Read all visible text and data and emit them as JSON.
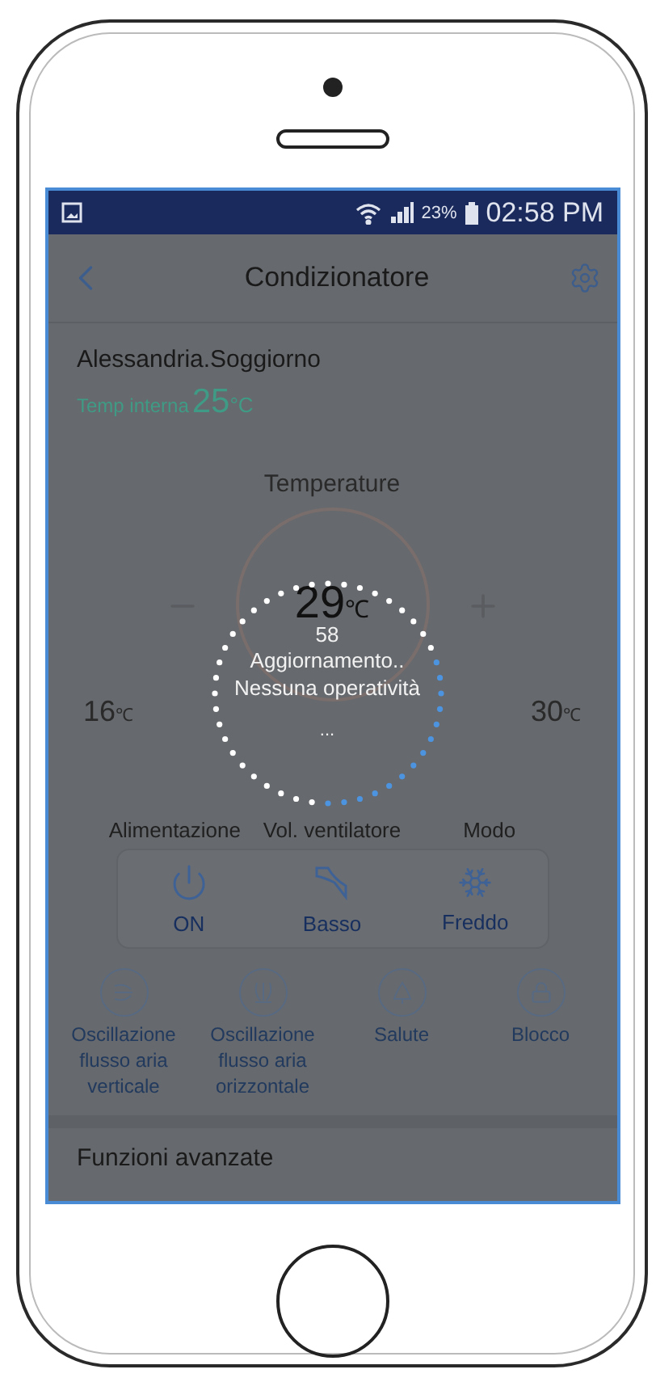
{
  "status_bar": {
    "battery": "23%",
    "time": "02:58 PM"
  },
  "header": {
    "title": "Condizionatore"
  },
  "room": {
    "name": "Alessandria.Soggiorno",
    "temp_label": "Temp interna",
    "temp_value": "25",
    "temp_unit": "°C"
  },
  "temperature": {
    "title": "Temperature",
    "value": "29",
    "unit": "℃",
    "min": {
      "value": "16",
      "unit": "℃"
    },
    "max": {
      "value": "30",
      "unit": "℃"
    }
  },
  "controls": [
    {
      "label": "Alimentazione",
      "value": "ON",
      "kind": "power"
    },
    {
      "label": "Vol. ventilatore",
      "value": "Basso",
      "kind": "fan"
    },
    {
      "label": "Modo",
      "value": "Freddo",
      "kind": "cool"
    }
  ],
  "functions": [
    {
      "label": "Oscillazione flusso aria verticale",
      "kind": "swing-vertical"
    },
    {
      "label": "Oscillazione flusso aria orizzontale",
      "kind": "swing-horizontal"
    },
    {
      "label": "Salute",
      "kind": "health"
    },
    {
      "label": "Blocco",
      "kind": "lock"
    }
  ],
  "loading": {
    "count": "58",
    "message": [
      "Aggiornamento..",
      "Nessuna operatività"
    ],
    "dots": "..."
  },
  "advanced": {
    "title": "Funzioni avanzate"
  }
}
